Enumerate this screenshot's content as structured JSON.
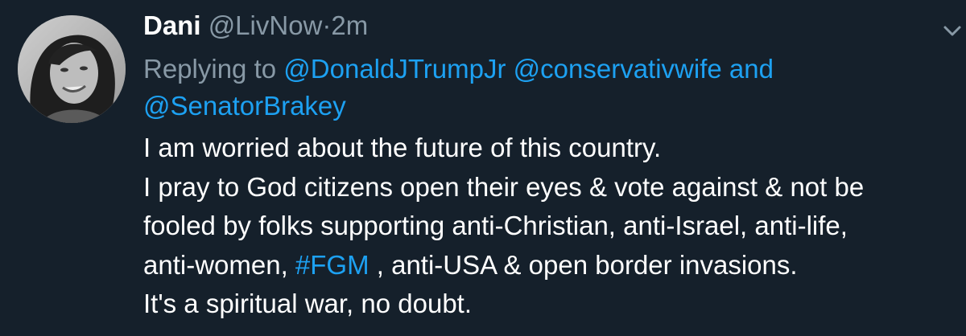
{
  "tweet": {
    "author_name": "Dani",
    "author_handle": "@LivNow",
    "separator": "·",
    "timestamp": "2m",
    "replying_prefix": "Replying to",
    "reply_mentions": [
      "@DonaldJTrumpJr",
      "@conservativwife",
      "@SenatorBrakey"
    ],
    "reply_joiner": "and",
    "body": {
      "line1": "I am worried about the future of this country.",
      "line2": "I pray to God citizens open their eyes & vote against & not be",
      "line3": "fooled by folks supporting anti-Christian, anti-Israel, anti-life,",
      "line4_before": "anti-women,",
      "hashtag": "#FGM",
      "line4_after": ", anti-USA & open border invasions.",
      "line5": "It's a spiritual war, no doubt."
    }
  },
  "colors": {
    "background": "#15202b",
    "text": "#ffffff",
    "secondary": "#8899a6",
    "link": "#1da1f2"
  },
  "icons": {
    "menu": "chevron-down-icon",
    "avatar": "profile-photo"
  }
}
